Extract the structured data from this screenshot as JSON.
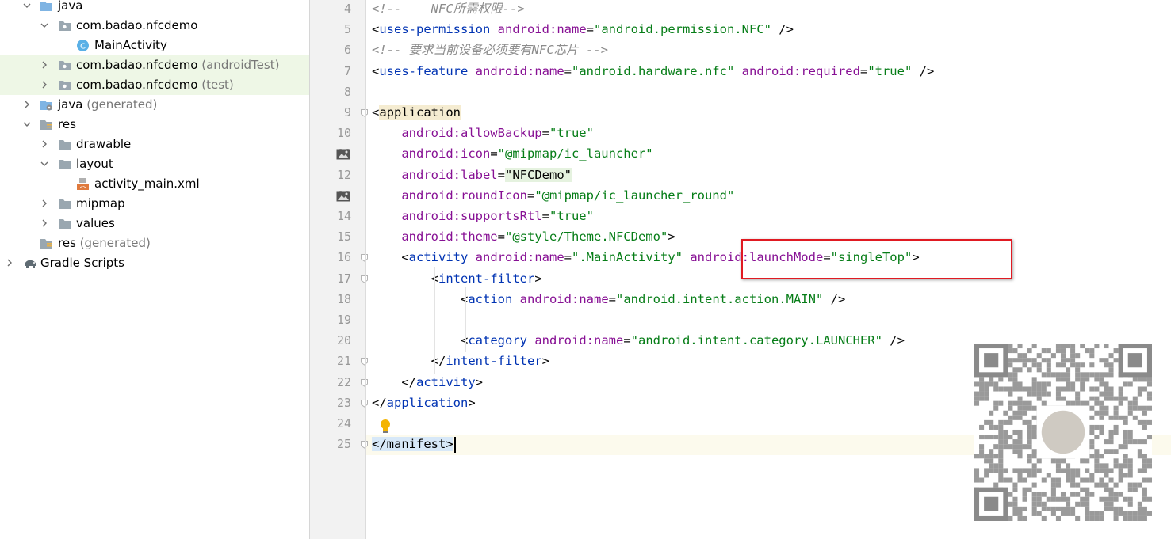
{
  "tree": {
    "items": [
      {
        "label": "java",
        "suffix": "",
        "icon": "folder-source-icon",
        "expanded": true,
        "highlighted": false
      },
      {
        "label": "com.badao.nfcdemo",
        "suffix": "",
        "icon": "package-icon",
        "expanded": true,
        "highlighted": false
      },
      {
        "label": "MainActivity",
        "suffix": "",
        "icon": "class-icon",
        "icon_letter": "C",
        "expanded": null,
        "highlighted": false
      },
      {
        "label": "com.badao.nfcdemo",
        "suffix": "(androidTest)",
        "icon": "package-icon",
        "expanded": false,
        "highlighted": true
      },
      {
        "label": "com.badao.nfcdemo",
        "suffix": "(test)",
        "icon": "package-icon",
        "expanded": false,
        "highlighted": true
      },
      {
        "label": "java",
        "suffix": "(generated)",
        "icon": "generated-folder-icon",
        "expanded": false,
        "highlighted": false
      },
      {
        "label": "res",
        "suffix": "",
        "icon": "resource-folder-icon",
        "expanded": true,
        "highlighted": false
      },
      {
        "label": "drawable",
        "suffix": "",
        "icon": "folder-icon",
        "expanded": false,
        "highlighted": false
      },
      {
        "label": "layout",
        "suffix": "",
        "icon": "folder-icon",
        "expanded": true,
        "highlighted": false
      },
      {
        "label": "activity_main.xml",
        "suffix": "",
        "icon": "layout-xml-icon",
        "expanded": null,
        "highlighted": false
      },
      {
        "label": "mipmap",
        "suffix": "",
        "icon": "folder-icon",
        "expanded": false,
        "highlighted": false
      },
      {
        "label": "values",
        "suffix": "",
        "icon": "folder-icon",
        "expanded": false,
        "highlighted": false
      },
      {
        "label": "res",
        "suffix": "(generated)",
        "icon": "resource-folder-icon",
        "expanded": null,
        "highlighted": false
      },
      {
        "label": "Gradle Scripts",
        "suffix": "",
        "icon": "gradle-elephant-icon",
        "expanded": false,
        "highlighted": false
      }
    ]
  },
  "editor": {
    "lines": [
      {
        "n": "4",
        "spans": [
          [
            "cm",
            "<!--    NFC所需权限-->"
          ]
        ]
      },
      {
        "n": "5",
        "spans": [
          [
            "pn",
            "<"
          ],
          [
            "tg",
            "uses-permission"
          ],
          [
            "pn",
            " "
          ],
          [
            "at",
            "android:"
          ],
          [
            "at",
            "name"
          ],
          [
            "pn",
            "="
          ],
          [
            "av",
            "\"android.permission.NFC\""
          ],
          [
            "pn",
            " />"
          ]
        ]
      },
      {
        "n": "6",
        "spans": [
          [
            "cm",
            "<!-- 要求当前设备必须要有NFC芯片 -->"
          ]
        ]
      },
      {
        "n": "7",
        "spans": [
          [
            "pn",
            "<"
          ],
          [
            "tg",
            "uses-feature"
          ],
          [
            "pn",
            " "
          ],
          [
            "at",
            "android:"
          ],
          [
            "at",
            "name"
          ],
          [
            "pn",
            "="
          ],
          [
            "av",
            "\"android.hardware.nfc\""
          ],
          [
            "pn",
            " "
          ],
          [
            "at",
            "android:"
          ],
          [
            "at",
            "required"
          ],
          [
            "pn",
            "="
          ],
          [
            "av",
            "\"true\""
          ],
          [
            "pn",
            " />"
          ]
        ]
      },
      {
        "n": "8",
        "spans": []
      },
      {
        "n": "9",
        "spans": [
          [
            "pn",
            "<"
          ],
          [
            "tg-hl",
            "application"
          ]
        ]
      },
      {
        "n": "10",
        "spans": [
          [
            "pn",
            "    "
          ],
          [
            "at",
            "android:"
          ],
          [
            "at",
            "allowBackup"
          ],
          [
            "pn",
            "="
          ],
          [
            "av",
            "\"true\""
          ]
        ]
      },
      {
        "n": "11",
        "spans": [
          [
            "pn",
            "    "
          ],
          [
            "at",
            "android:"
          ],
          [
            "at",
            "icon"
          ],
          [
            "pn",
            "="
          ],
          [
            "av",
            "\"@mipmap/ic_launcher\""
          ]
        ]
      },
      {
        "n": "12",
        "spans": [
          [
            "pn",
            "    "
          ],
          [
            "at",
            "android:"
          ],
          [
            "at",
            "label"
          ],
          [
            "pn",
            "="
          ],
          [
            "av-hl",
            "\"NFCDemo\""
          ]
        ]
      },
      {
        "n": "13",
        "spans": [
          [
            "pn",
            "    "
          ],
          [
            "at",
            "android:"
          ],
          [
            "at",
            "roundIcon"
          ],
          [
            "pn",
            "="
          ],
          [
            "av",
            "\"@mipmap/ic_launcher_round\""
          ]
        ]
      },
      {
        "n": "14",
        "spans": [
          [
            "pn",
            "    "
          ],
          [
            "at",
            "android:"
          ],
          [
            "at",
            "supportsRtl"
          ],
          [
            "pn",
            "="
          ],
          [
            "av",
            "\"true\""
          ]
        ]
      },
      {
        "n": "15",
        "spans": [
          [
            "pn",
            "    "
          ],
          [
            "at",
            "android:"
          ],
          [
            "at",
            "theme"
          ],
          [
            "pn",
            "="
          ],
          [
            "av",
            "\"@style/Theme.NFCDemo\""
          ],
          [
            "pn",
            ">"
          ]
        ]
      },
      {
        "n": "16",
        "spans": [
          [
            "pn",
            "    <"
          ],
          [
            "tg",
            "activity"
          ],
          [
            "pn",
            " "
          ],
          [
            "at",
            "android:"
          ],
          [
            "at",
            "name"
          ],
          [
            "pn",
            "="
          ],
          [
            "av",
            "\".MainActivity\""
          ],
          [
            "pn",
            " "
          ],
          [
            "at",
            "android:"
          ],
          [
            "at",
            "launchMode"
          ],
          [
            "pn",
            "="
          ],
          [
            "av",
            "\"singleTop\""
          ],
          [
            "pn",
            ">"
          ]
        ]
      },
      {
        "n": "17",
        "spans": [
          [
            "pn",
            "        <"
          ],
          [
            "tg",
            "intent-filter"
          ],
          [
            "pn",
            ">"
          ]
        ]
      },
      {
        "n": "18",
        "spans": [
          [
            "pn",
            "            <"
          ],
          [
            "tg",
            "action"
          ],
          [
            "pn",
            " "
          ],
          [
            "at",
            "android:"
          ],
          [
            "at",
            "name"
          ],
          [
            "pn",
            "="
          ],
          [
            "av",
            "\"android.intent.action.MAIN\""
          ],
          [
            "pn",
            " />"
          ]
        ]
      },
      {
        "n": "19",
        "spans": []
      },
      {
        "n": "20",
        "spans": [
          [
            "pn",
            "            <"
          ],
          [
            "tg",
            "category"
          ],
          [
            "pn",
            " "
          ],
          [
            "at",
            "android:"
          ],
          [
            "at",
            "name"
          ],
          [
            "pn",
            "="
          ],
          [
            "av",
            "\"android.intent.category.LAUNCHER\""
          ],
          [
            "pn",
            " />"
          ]
        ]
      },
      {
        "n": "21",
        "spans": [
          [
            "pn",
            "        </"
          ],
          [
            "tg",
            "intent-filter"
          ],
          [
            "pn",
            ">"
          ]
        ]
      },
      {
        "n": "22",
        "spans": [
          [
            "pn",
            "    </"
          ],
          [
            "tg",
            "activity"
          ],
          [
            "pn",
            ">"
          ]
        ]
      },
      {
        "n": "23",
        "spans": [
          [
            "pn",
            "</"
          ],
          [
            "tg",
            "application"
          ],
          [
            "pn",
            ">"
          ]
        ]
      },
      {
        "n": "24",
        "spans": []
      },
      {
        "n": "25",
        "spans": [
          [
            "tg-match",
            "</"
          ],
          [
            "tg-match",
            "manifest"
          ],
          [
            "tg-match",
            ">"
          ]
        ]
      }
    ],
    "gutter_image_lines": [
      "11",
      "13"
    ],
    "fold_lines": [
      "9",
      "16",
      "17",
      "21",
      "22",
      "23",
      "25"
    ],
    "current_line": "25"
  },
  "colors": {
    "tag": "#0033b3",
    "attribute": "#871094",
    "value": "#067d17",
    "comment": "#8c8c8c",
    "annotation_box": "#e01a22"
  }
}
